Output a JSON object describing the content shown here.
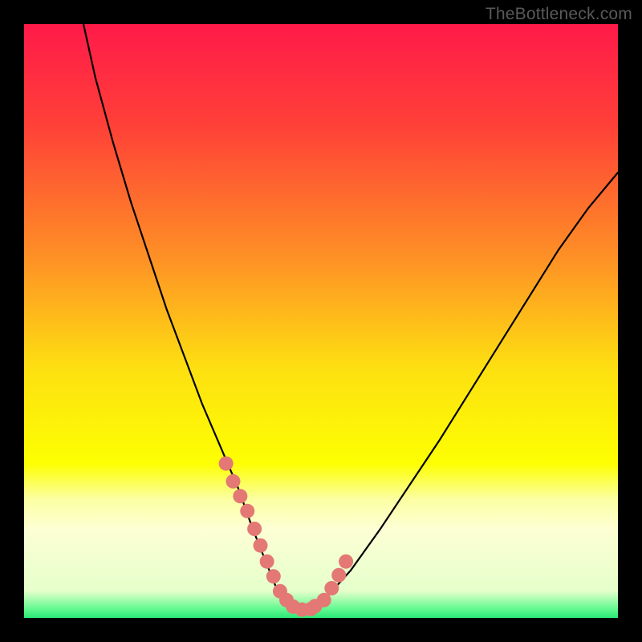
{
  "watermark": "TheBottleneck.com",
  "chart_data": {
    "type": "line",
    "title": "",
    "xlabel": "",
    "ylabel": "",
    "xlim": [
      0,
      100
    ],
    "ylim": [
      0,
      100
    ],
    "background_gradient": {
      "stops": [
        {
          "pos": 0.0,
          "color": "#ff1a49"
        },
        {
          "pos": 0.17,
          "color": "#ff4038"
        },
        {
          "pos": 0.4,
          "color": "#fe9325"
        },
        {
          "pos": 0.58,
          "color": "#fde011"
        },
        {
          "pos": 0.74,
          "color": "#fdff02"
        },
        {
          "pos": 0.8,
          "color": "#fcffa2"
        },
        {
          "pos": 0.85,
          "color": "#fdffd4"
        },
        {
          "pos": 0.955,
          "color": "#e5ffcb"
        },
        {
          "pos": 0.985,
          "color": "#61f98f"
        },
        {
          "pos": 1.0,
          "color": "#2ae876"
        }
      ]
    },
    "series": [
      {
        "name": "bottleneck-curve",
        "x": [
          10,
          12,
          15,
          18,
          21,
          24,
          27,
          30,
          33,
          36,
          38.5,
          40.5,
          42.5,
          44,
          46,
          48,
          50,
          55,
          60,
          65,
          70,
          75,
          80,
          85,
          90,
          95,
          100
        ],
        "y": [
          100,
          91,
          80,
          70,
          61,
          52,
          44,
          36,
          29,
          22,
          15,
          10,
          5,
          2.5,
          1.5,
          1.5,
          2.5,
          8,
          15,
          22.5,
          30,
          38,
          46,
          54,
          62,
          69,
          75
        ]
      }
    ],
    "highlight": {
      "name": "optimal-range",
      "color": "#e37875",
      "segments": [
        {
          "x": [
            34.0,
            35.2,
            36.4,
            37.6,
            38.8,
            39.8,
            40.9,
            42.0,
            43.1,
            44.2,
            45.3,
            46.8,
            48.3
          ],
          "y": [
            26.0,
            23.0,
            20.5,
            18.0,
            15.0,
            12.2,
            9.5,
            7.0,
            4.5,
            3.0,
            1.9,
            1.4,
            1.5
          ]
        },
        {
          "x": [
            49.0,
            50.5,
            51.8,
            53.0,
            54.2
          ],
          "y": [
            2.0,
            3.0,
            5.0,
            7.2,
            9.5
          ]
        }
      ]
    }
  }
}
